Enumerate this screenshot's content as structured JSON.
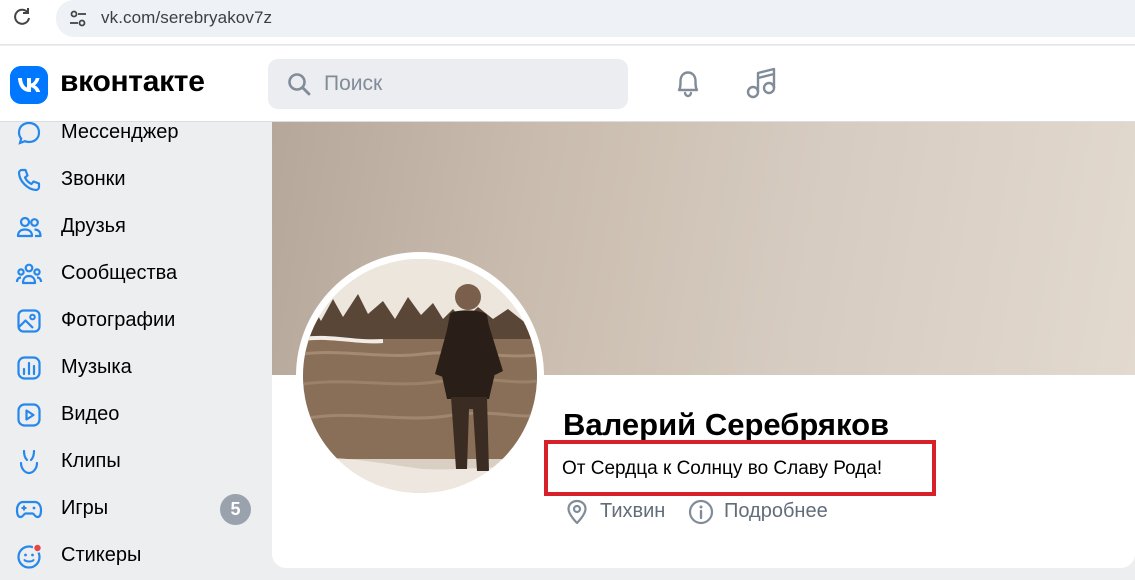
{
  "browser": {
    "url": "vk.com/serebryakov7z"
  },
  "header": {
    "logo_text": "вконтакте",
    "search_placeholder": "Поиск"
  },
  "sidebar": {
    "items": [
      {
        "label": "Мессенджер",
        "icon": "message-icon"
      },
      {
        "label": "Звонки",
        "icon": "phone-icon"
      },
      {
        "label": "Друзья",
        "icon": "friends-icon"
      },
      {
        "label": "Сообщества",
        "icon": "communities-icon"
      },
      {
        "label": "Фотографии",
        "icon": "photo-icon"
      },
      {
        "label": "Музыка",
        "icon": "music-wave-icon"
      },
      {
        "label": "Видео",
        "icon": "video-icon"
      },
      {
        "label": "Клипы",
        "icon": "clips-icon"
      },
      {
        "label": "Игры",
        "icon": "gamepad-icon",
        "badge": "5"
      },
      {
        "label": "Стикеры",
        "icon": "sticker-icon"
      }
    ]
  },
  "profile": {
    "name": "Валерий Серебряков",
    "status": "От Сердца к Солнцу во Славу Рода!",
    "city": "Тихвин",
    "details_link": "Подробнее"
  },
  "colors": {
    "accent": "#0077ff",
    "highlight_box": "#d6202a",
    "secondary_text": "#626d7a",
    "badge": "#99a2ad"
  }
}
